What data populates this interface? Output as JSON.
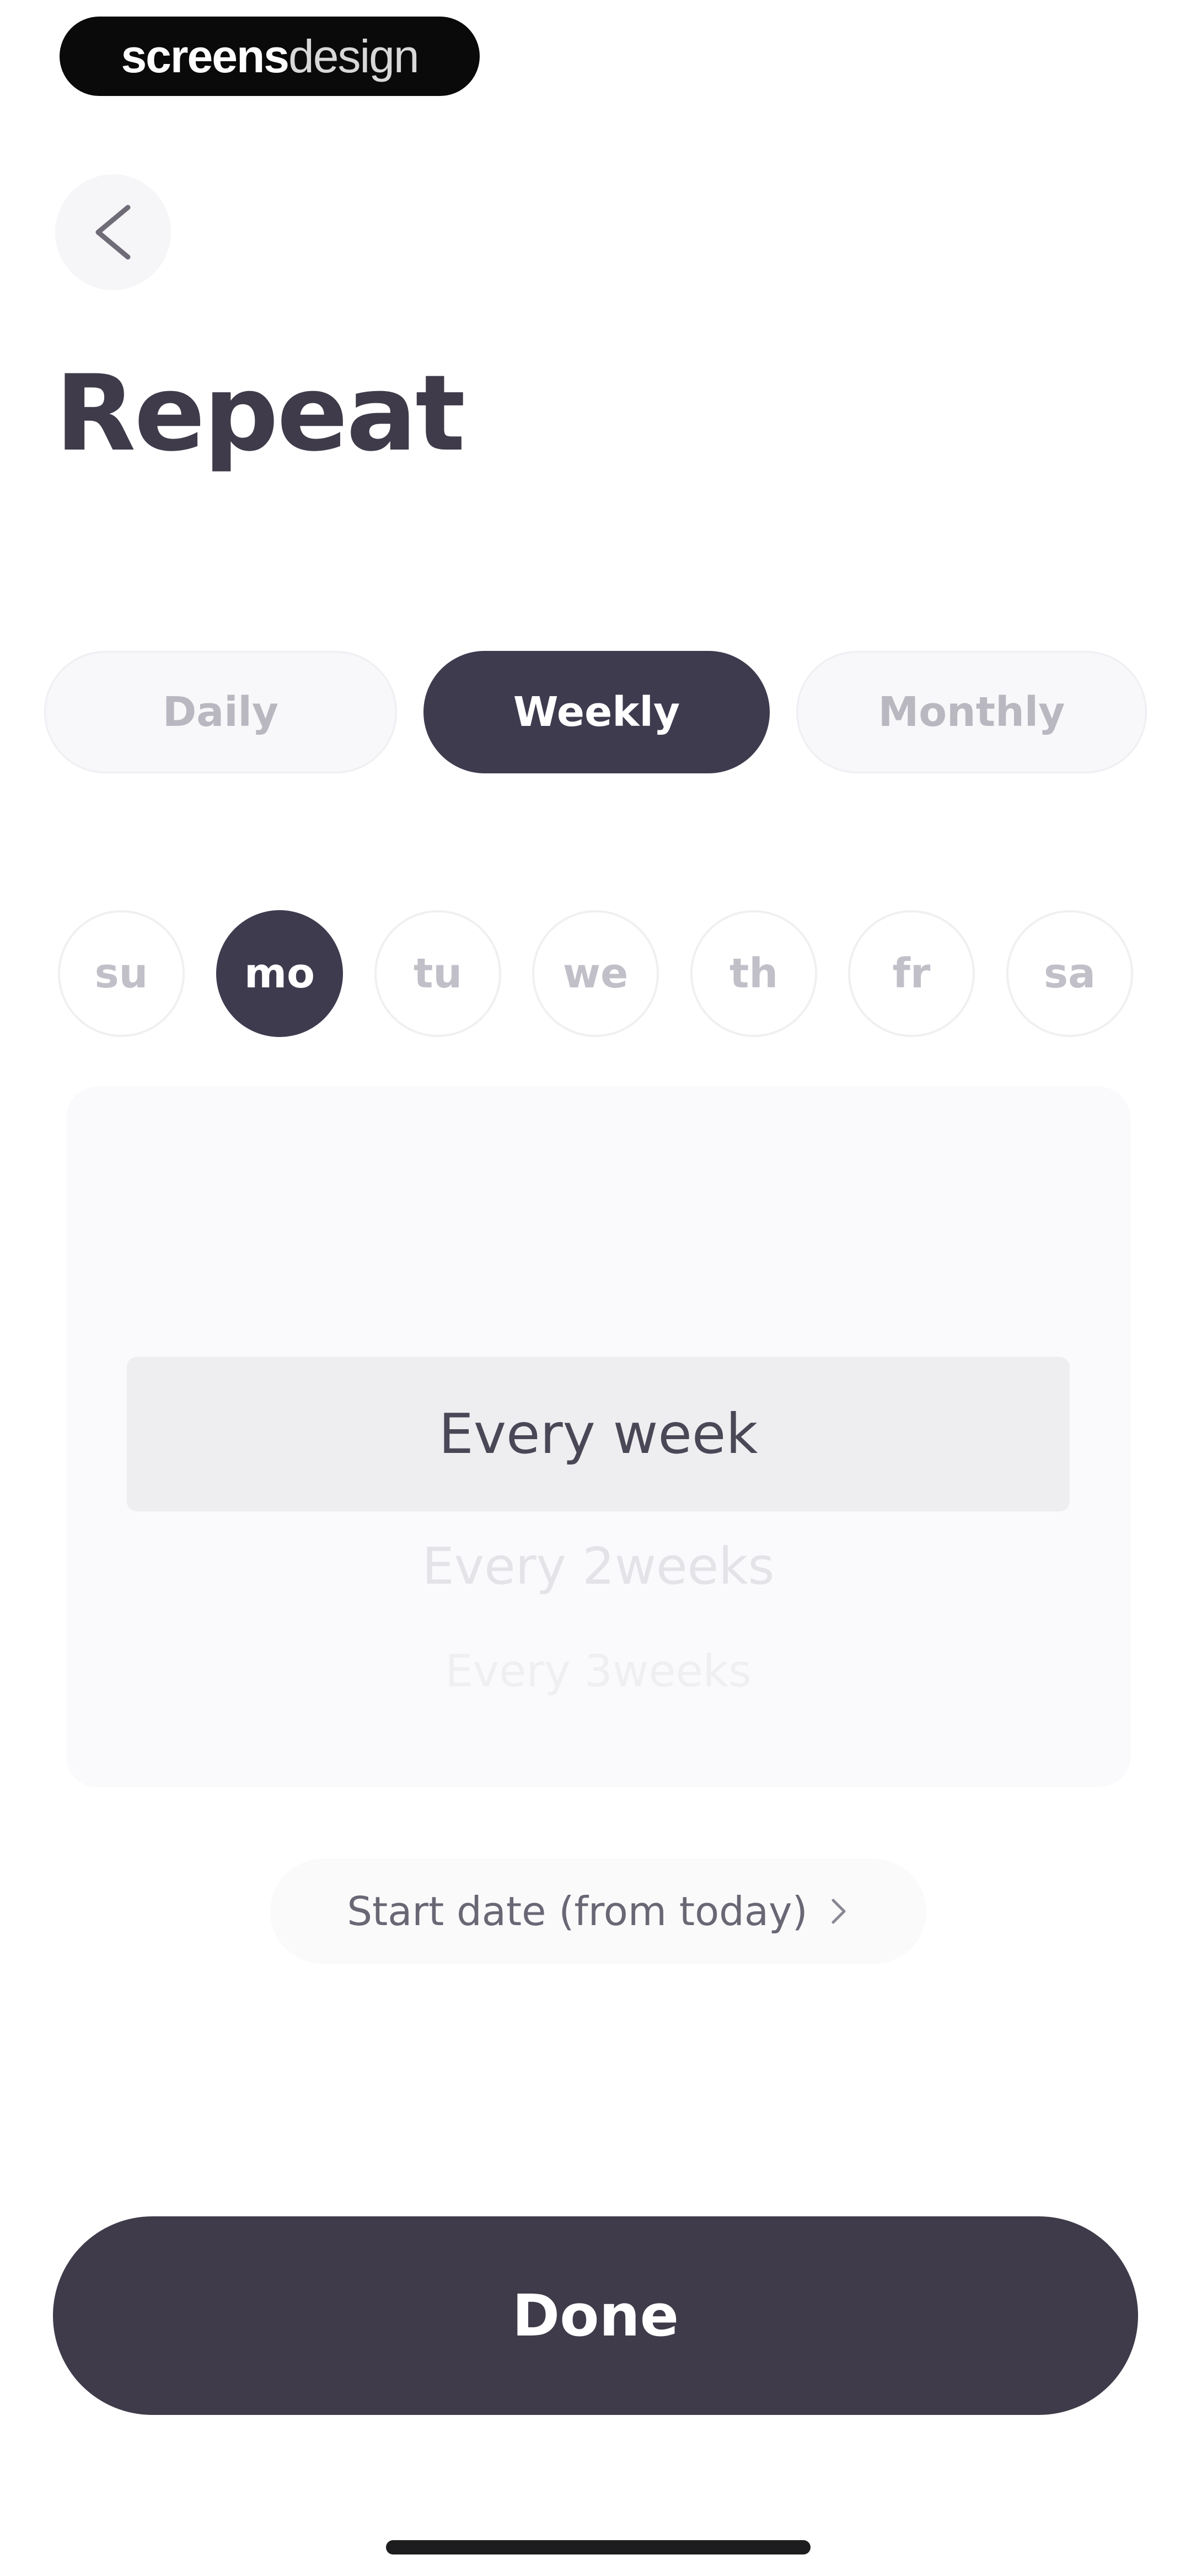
{
  "watermark": {
    "part_bold": "screens",
    "part_light": "design"
  },
  "header": {
    "back_icon": "chevron-left-icon",
    "title": "Repeat"
  },
  "frequency_tabs": [
    {
      "label": "Daily",
      "selected": false
    },
    {
      "label": "Weekly",
      "selected": true
    },
    {
      "label": "Monthly",
      "selected": false
    }
  ],
  "days": [
    {
      "label": "su",
      "selected": false
    },
    {
      "label": "mo",
      "selected": true
    },
    {
      "label": "tu",
      "selected": false
    },
    {
      "label": "we",
      "selected": false
    },
    {
      "label": "th",
      "selected": false
    },
    {
      "label": "fr",
      "selected": false
    },
    {
      "label": "sa",
      "selected": false
    }
  ],
  "interval_picker": {
    "options": [
      "Every week",
      "Every 2weeks",
      "Every 3weeks"
    ],
    "selected": "Every week"
  },
  "start_date": {
    "label": "Start date (from today)",
    "icon": "chevron-right-icon"
  },
  "done_label": "Done",
  "colors": {
    "accent": "#3f3b4f",
    "text": "#3f3b4a",
    "muted": "#b9b7c0",
    "background": "#ffffff"
  }
}
